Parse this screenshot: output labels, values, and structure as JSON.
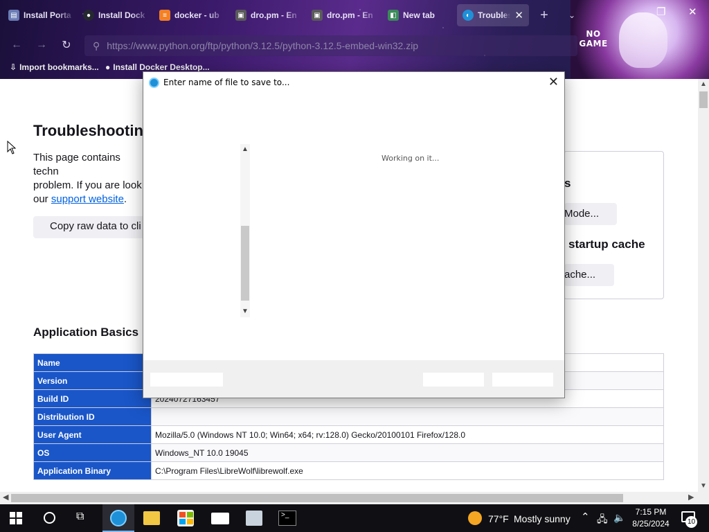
{
  "browser": {
    "tabs": [
      {
        "label": "Install Porta",
        "icon": "page-icon",
        "color": "#6a7cb5"
      },
      {
        "label": "Install Dock",
        "icon": "github-icon",
        "color": "#24292f"
      },
      {
        "label": "docker - ub",
        "icon": "stackoverflow-icon",
        "color": "#f48024"
      },
      {
        "label": "dro.pm - En",
        "icon": "dropm-icon",
        "color": "#5a5a5a"
      },
      {
        "label": "dro.pm - En",
        "icon": "dropm-icon",
        "color": "#5a5a5a"
      },
      {
        "label": "New tab",
        "icon": "newtab-icon",
        "color": "#3a8a5a"
      },
      {
        "label": "Troublesh",
        "icon": "librewolf-icon",
        "color": "#1e90d8",
        "active": true
      }
    ],
    "url": "https://www.python.org/ftp/python/3.12.5/python-3.12.5-embed-win32.zip",
    "bookmarks": [
      {
        "label": "Import bookmarks...",
        "icon": "import-icon"
      },
      {
        "label": "Install Docker Desktop...",
        "icon": "github-icon"
      }
    ],
    "theme_text": "NO GAME"
  },
  "page": {
    "title": "Troubleshootin",
    "intro_lines": [
      "This page contains techn",
      "problem. If you are look"
    ],
    "intro_prefix": "our ",
    "support_link": "support website",
    "intro_suffix": ".",
    "copy_button": "Copy raw data to cli",
    "right_s": "s",
    "right_btn1": "Mode...",
    "right_heading2": "startup cache",
    "right_btn2": "ache...",
    "basics_heading": "Application Basics",
    "table": [
      {
        "key": "Name",
        "value": ""
      },
      {
        "key": "Version",
        "value": ""
      },
      {
        "key": "Build ID",
        "value": "20240727163457"
      },
      {
        "key": "Distribution ID",
        "value": ""
      },
      {
        "key": "User Agent",
        "value": "Mozilla/5.0 (Windows NT 10.0; Win64; x64; rv:128.0) Gecko/20100101 Firefox/128.0"
      },
      {
        "key": "OS",
        "value": "Windows_NT 10.0 19045"
      },
      {
        "key": "Application Binary",
        "value": "C:\\Program Files\\LibreWolf\\librewolf.exe"
      }
    ]
  },
  "dialog": {
    "title": "Enter name of file to save to...",
    "status": "Working on it..."
  },
  "taskbar": {
    "weather_temp": "77°F",
    "weather_desc": "Mostly sunny",
    "time": "7:15 PM",
    "date": "8/25/2024",
    "notifications": "10"
  }
}
